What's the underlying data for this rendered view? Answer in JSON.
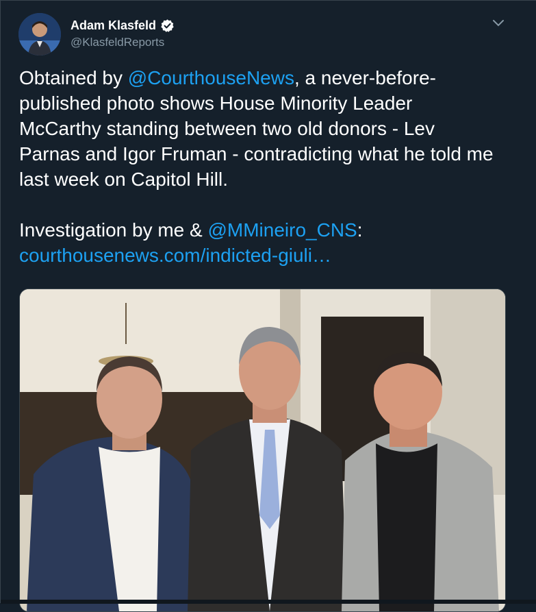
{
  "author": {
    "display_name": "Adam Klasfeld",
    "handle": "@KlasfeldReports",
    "verified_icon": "verified-badge-icon"
  },
  "tweet": {
    "line1_pre": "Obtained by ",
    "mention1": "@CourthouseNews",
    "line1_post": ", a never-before-published photo shows House Minority Leader McCarthy standing between two old donors - Lev Parnas and Igor Fruman - contradicting what he told me last week on Capitol Hill.",
    "line2_pre": "Investigation by me & ",
    "mention2": "@MMineiro_CNS",
    "line2_post": ":",
    "link": "courthousenews.com/indicted-giuli…"
  },
  "media": {
    "description_icon": "photo-three-men-icon"
  },
  "colors": {
    "background": "#15202b",
    "accent": "#1da1f2",
    "secondary_text": "#8899a6"
  }
}
